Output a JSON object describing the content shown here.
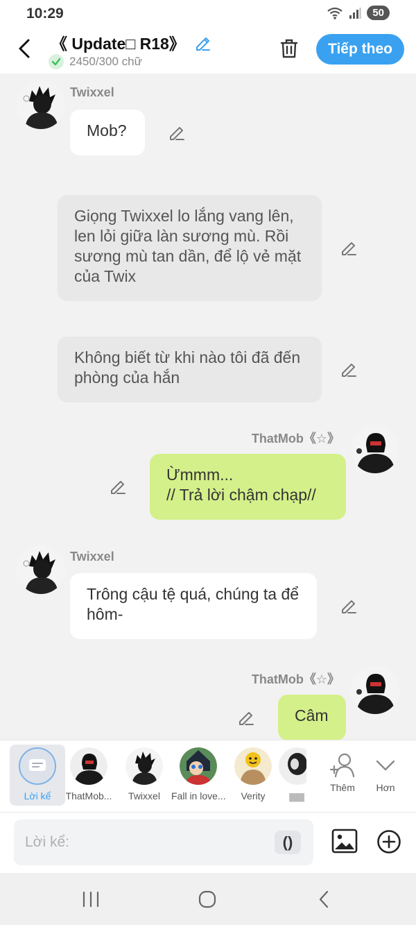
{
  "status": {
    "time": "10:29",
    "battery": "50"
  },
  "header": {
    "title": "《 Update□ R18》",
    "word_count": "2450/300 chữ",
    "next_label": "Tiếp theo",
    "accent": "#3aa1f0"
  },
  "messages": [
    {
      "speaker": "Twixxel",
      "text": "Mob?",
      "style": "white"
    },
    {
      "text": "Giọng Twixxel lo lắng vang lên, len lỏi giữa làn sương mù. Rồi sương mù tan dần, để lộ vẻ mặt của Twix",
      "style": "gray"
    },
    {
      "text": "Không biết từ khi nào tôi đã đến phòng của hắn",
      "style": "gray"
    },
    {
      "speaker": "ThatMob《☆》",
      "text": "Ừmmm...\n// Trả lời chậm chạp//",
      "style": "green"
    },
    {
      "speaker": "Twixxel",
      "text": "Trông cậu tệ quá, chúng ta để hôm-",
      "style": "white"
    },
    {
      "speaker": "ThatMob《☆》",
      "text": "Câm",
      "style": "green"
    }
  ],
  "characters": [
    {
      "label": "Lời kể",
      "icon": "narration-icon"
    },
    {
      "label": "ThatMob..."
    },
    {
      "label": "Twixxel"
    },
    {
      "label": "Fall in love..."
    },
    {
      "label": "Verity"
    },
    {
      "label": "▆▆"
    },
    {
      "label": "Thêm",
      "icon": "add-user-icon"
    },
    {
      "label": "Hơn",
      "icon": "chevron-down-icon"
    }
  ],
  "input": {
    "placeholder": "Lời kể:",
    "paren": "()"
  }
}
